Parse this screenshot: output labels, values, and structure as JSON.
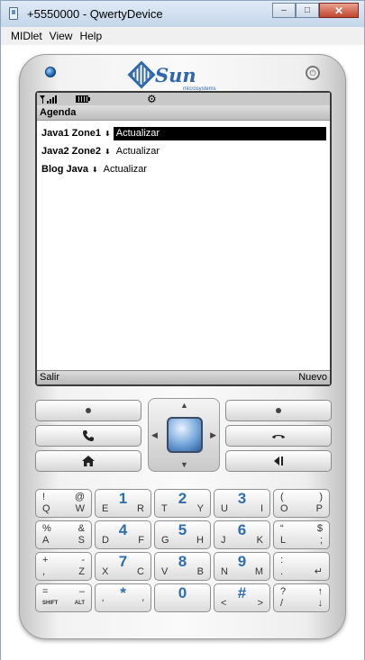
{
  "window": {
    "title": "+5550000 - QwertyDevice",
    "minimize": "–",
    "maximize": "□",
    "close": "✕"
  },
  "menu": [
    "MIDlet",
    "View",
    "Help"
  ],
  "device": {
    "brand": "Sun",
    "brand_sub": "microsystems",
    "power_glyph": "⏻"
  },
  "screen": {
    "title": "Agenda",
    "rows": [
      {
        "name": "Java1 Zone1",
        "action": "Actualizar",
        "selected": true
      },
      {
        "name": "Java2 Zone2",
        "action": "Actualizar",
        "selected": false
      },
      {
        "name": "Blog Java",
        "action": "Actualizar",
        "selected": false
      }
    ],
    "arrow_glyph": "⬇",
    "gear_glyph": "⚙",
    "softkeys": {
      "left": "Salir",
      "right": "Nuevo"
    }
  },
  "nav": {
    "call_glyph": "📞",
    "home_glyph": "⌂",
    "end_glyph": "☎",
    "back_glyph": "◂|",
    "up": "▲",
    "down": "▼",
    "left": "◀",
    "right": "▶"
  },
  "keyboard": [
    [
      {
        "tl": "!",
        "tr": "@",
        "bl": "Q",
        "br": "W"
      },
      {
        "num": "1",
        "bl": "E",
        "br": "R"
      },
      {
        "num": "2",
        "bl": "T",
        "br": "Y"
      },
      {
        "num": "3",
        "bl": "U",
        "br": "I"
      },
      {
        "tl": "(",
        "tr": ")",
        "bl": "O",
        "br": "P"
      }
    ],
    [
      {
        "tl": "%",
        "tr": "&",
        "bl": "A",
        "br": "S"
      },
      {
        "num": "4",
        "bl": "D",
        "br": "F"
      },
      {
        "num": "5",
        "bl": "G",
        "br": "H"
      },
      {
        "num": "6",
        "bl": "J",
        "br": "K"
      },
      {
        "tl": "“",
        "tr": "$",
        "bl": "L",
        "br": ";"
      }
    ],
    [
      {
        "tl": "+",
        "tr": "-",
        "bl": ",",
        "br": "Z"
      },
      {
        "num": "7",
        "bl": "X",
        "br": "C"
      },
      {
        "num": "8",
        "bl": "V",
        "br": "B"
      },
      {
        "num": "9",
        "bl": "N",
        "br": "M"
      },
      {
        "tl": ":",
        "tr": "",
        "bl": ".",
        "br": "↵"
      }
    ],
    [
      {
        "tl": "=",
        "tr": "–",
        "bl": "SHIFT",
        "br": "ALT",
        "small": true
      },
      {
        "num": "*",
        "bl": "‘",
        "br": "’"
      },
      {
        "num": "0",
        "bl": "",
        "br": ""
      },
      {
        "num": "#",
        "bl": "<",
        "br": ">"
      },
      {
        "tl": "?",
        "tr": "↑",
        "bl": "/",
        "br": "↓"
      }
    ]
  ]
}
